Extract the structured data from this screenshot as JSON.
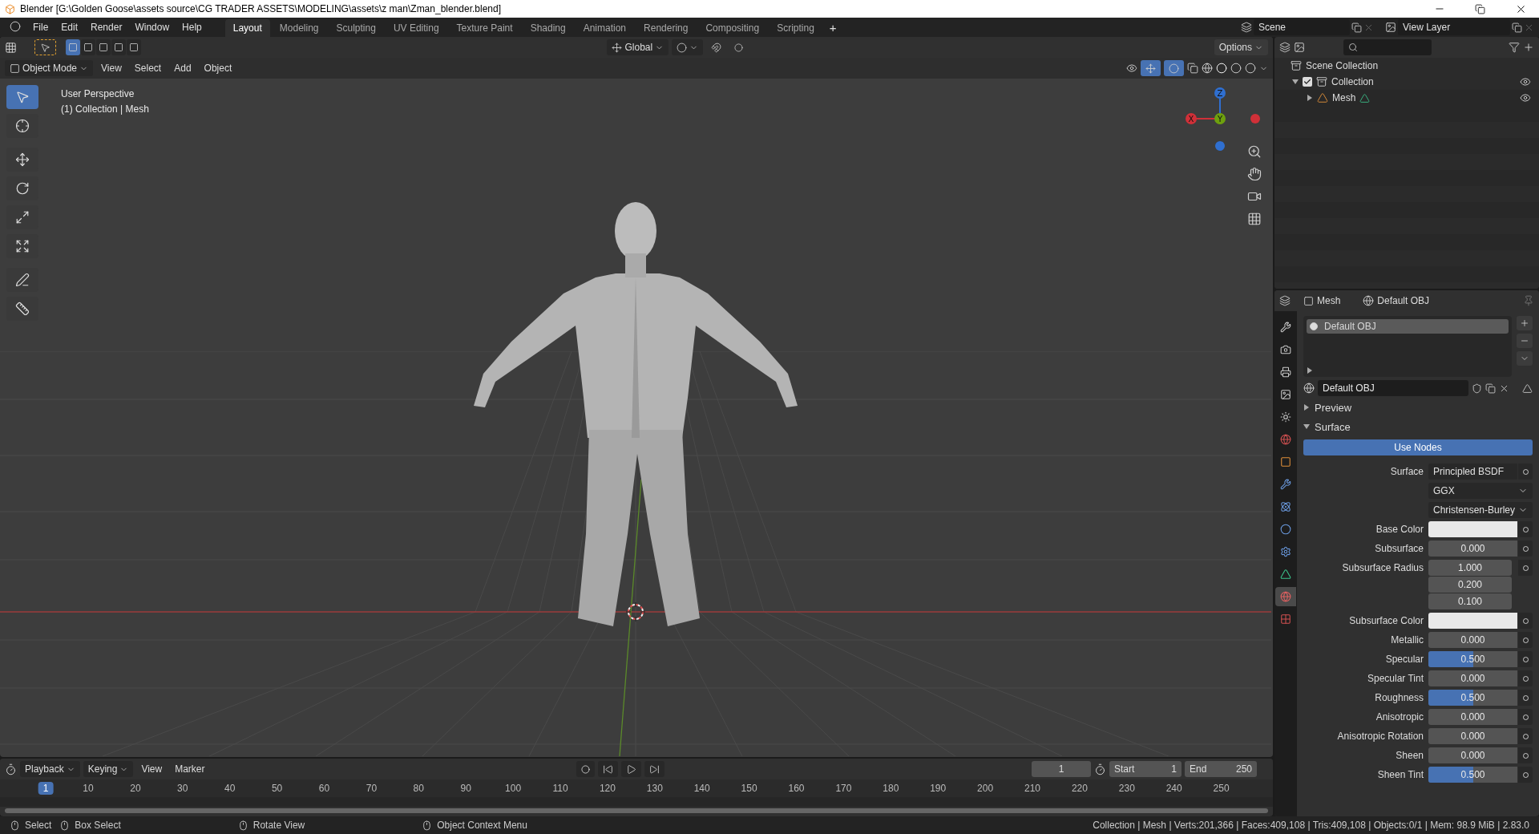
{
  "window": {
    "title": "Blender [G:\\Golden Goose\\assets source\\CG TRADER ASSETS\\MODELING\\assets\\z man\\Zman_blender.blend]"
  },
  "menu": [
    "File",
    "Edit",
    "Render",
    "Window",
    "Help"
  ],
  "workspaces": [
    {
      "label": "Layout",
      "selected": true
    },
    {
      "label": "Modeling",
      "selected": false
    },
    {
      "label": "Sculpting",
      "selected": false
    },
    {
      "label": "UV Editing",
      "selected": false
    },
    {
      "label": "Texture Paint",
      "selected": false
    },
    {
      "label": "Shading",
      "selected": false
    },
    {
      "label": "Animation",
      "selected": false
    },
    {
      "label": "Rendering",
      "selected": false
    },
    {
      "label": "Compositing",
      "selected": false
    },
    {
      "label": "Scripting",
      "selected": false
    }
  ],
  "add_workspace": "+",
  "scene": "Scene",
  "view_layer": "View Layer",
  "tool_header": {
    "select_modes": [
      {
        "selected": true
      },
      {
        "selected": false
      },
      {
        "selected": false
      },
      {
        "selected": false
      },
      {
        "selected": false
      }
    ],
    "orientation": "Global",
    "options": "Options"
  },
  "viewport": {
    "mode": "Object Mode",
    "menus": [
      "View",
      "Select",
      "Add",
      "Object"
    ],
    "overlay": [
      "User Perspective",
      "(1) Collection | Mesh"
    ],
    "tools": [
      {
        "selected": true
      },
      {
        "selected": false
      },
      {
        "selected": false
      },
      {
        "selected": false
      },
      {
        "selected": false
      },
      {
        "selected": false
      },
      {
        "selected": false
      },
      {
        "selected": false
      }
    ],
    "gizmo": [
      {
        "label": "Z",
        "color": "#2f6fd0"
      },
      {
        "label": "X",
        "color": "#d03038"
      },
      {
        "label": "Y",
        "color": "#6ea00e"
      }
    ]
  },
  "outliner": {
    "root": "Scene Collection",
    "tree": [
      {
        "name": "Collection",
        "checked": true,
        "expanded": true,
        "children": [
          {
            "name": "Mesh",
            "expanded": false
          }
        ]
      }
    ]
  },
  "properties": {
    "object": "Mesh",
    "material": "Default OBJ",
    "tabs": [
      {
        "selected": false
      },
      {
        "selected": false
      },
      {
        "selected": false
      },
      {
        "selected": false
      },
      {
        "selected": false
      },
      {
        "selected": false
      },
      {
        "selected": false
      },
      {
        "selected": false
      },
      {
        "selected": false
      },
      {
        "selected": false
      },
      {
        "selected": false
      },
      {
        "selected": false
      },
      {
        "selected": true
      },
      {
        "selected": false
      }
    ],
    "slots": [
      {
        "name": "Default OBJ",
        "selected": true
      }
    ],
    "material_field": "Default OBJ",
    "panels": [
      {
        "label": "Preview",
        "expanded": false
      },
      {
        "label": "Surface",
        "expanded": true
      }
    ],
    "use_nodes": "Use Nodes",
    "rows": [
      {
        "kind": "menu",
        "label": "Surface",
        "value": "Principled BSDF"
      },
      {
        "kind": "dropdown",
        "value": "GGX"
      },
      {
        "kind": "dropdown",
        "value": "Christensen-Burley"
      },
      {
        "kind": "color",
        "label": "Base Color",
        "color": "#e8e8e8"
      },
      {
        "kind": "slider",
        "label": "Subsurface",
        "value": "0.000",
        "level": 0
      },
      {
        "kind": "vector",
        "label": "Subsurface Radius",
        "values": [
          "1.000",
          "0.200",
          "0.100"
        ]
      },
      {
        "kind": "color",
        "label": "Subsurface Color",
        "color": "#e8e8e8"
      },
      {
        "kind": "slider",
        "label": "Metallic",
        "value": "0.000",
        "level": 0
      },
      {
        "kind": "slider",
        "label": "Specular",
        "value": "0.500",
        "level": 0.5
      },
      {
        "kind": "slider",
        "label": "Specular Tint",
        "value": "0.000",
        "level": 0
      },
      {
        "kind": "slider",
        "label": "Roughness",
        "value": "0.500",
        "level": 0.5
      },
      {
        "kind": "slider",
        "label": "Anisotropic",
        "value": "0.000",
        "level": 0
      },
      {
        "kind": "slider",
        "label": "Anisotropic Rotation",
        "value": "0.000",
        "level": 0
      },
      {
        "kind": "slider",
        "label": "Sheen",
        "value": "0.000",
        "level": 0
      },
      {
        "kind": "slider",
        "label": "Sheen Tint",
        "value": "0.500",
        "level": 0.5
      }
    ]
  },
  "timeline": {
    "menus": [
      "Playback",
      "Keying",
      "View",
      "Marker"
    ],
    "current_frame": "1",
    "start_label": "Start",
    "start": "1",
    "end_label": "End",
    "end": "250",
    "frames": [
      {
        "label": "1",
        "selected": true
      },
      {
        "label": "10",
        "selected": false
      },
      {
        "label": "20",
        "selected": false
      },
      {
        "label": "30",
        "selected": false
      },
      {
        "label": "40",
        "selected": false
      },
      {
        "label": "50",
        "selected": false
      },
      {
        "label": "60",
        "selected": false
      },
      {
        "label": "70",
        "selected": false
      },
      {
        "label": "80",
        "selected": false
      },
      {
        "label": "90",
        "selected": false
      },
      {
        "label": "100",
        "selected": false
      },
      {
        "label": "110",
        "selected": false
      },
      {
        "label": "120",
        "selected": false
      },
      {
        "label": "130",
        "selected": false
      },
      {
        "label": "140",
        "selected": false
      },
      {
        "label": "150",
        "selected": false
      },
      {
        "label": "160",
        "selected": false
      },
      {
        "label": "170",
        "selected": false
      },
      {
        "label": "180",
        "selected": false
      },
      {
        "label": "190",
        "selected": false
      },
      {
        "label": "200",
        "selected": false
      },
      {
        "label": "210",
        "selected": false
      },
      {
        "label": "220",
        "selected": false
      },
      {
        "label": "230",
        "selected": false
      },
      {
        "label": "240",
        "selected": false
      },
      {
        "label": "250",
        "selected": false
      }
    ]
  },
  "status": {
    "actions": [
      "Select",
      "Box Select",
      "Rotate View",
      "Object Context Menu"
    ],
    "stats": "Collection | Mesh | Verts:201,366 | Faces:409,108 | Tris:409,108 | Objects:0/1 | Mem: 98.9 MiB | 2.83.0"
  }
}
